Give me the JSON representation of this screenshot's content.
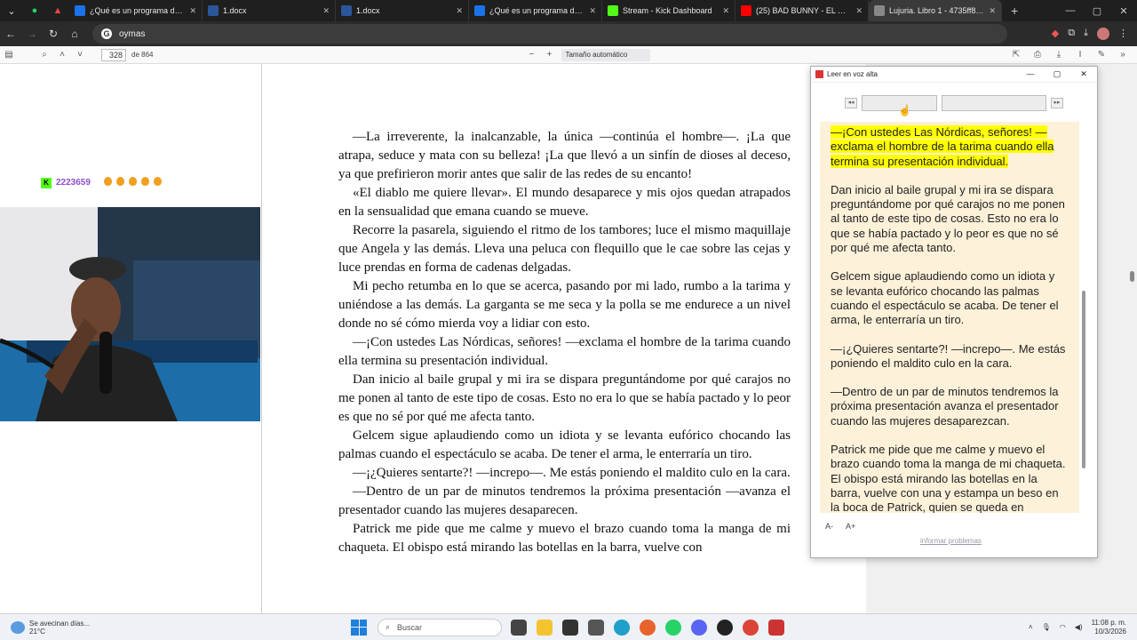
{
  "tabs": [
    {
      "title": "¿Qué es un programa de pr",
      "color": "#1a73e8"
    },
    {
      "title": "1.docx",
      "color": "#2b579a"
    },
    {
      "title": "1.docx",
      "color": "#2b579a"
    },
    {
      "title": "¿Qué es un programa de pr",
      "color": "#1a73e8"
    },
    {
      "title": "Stream - Kick Dashboard",
      "color": "#53fc18"
    },
    {
      "title": "(25) BAD BUNNY - EL CLÚB",
      "color": "#ff0000"
    },
    {
      "title": "Lujuria. Libro 1 - 4735ff84-a",
      "color": "#888888"
    }
  ],
  "address": {
    "text": "oymas"
  },
  "pdf": {
    "page": "328",
    "of_pages": "de 864",
    "zoom": "Tamaño automático"
  },
  "overlay": {
    "viewer_count": "2223659"
  },
  "document": {
    "paragraphs": [
      "—La irreverente, la inalcanzable, la única —continúa el hombre—. ¡La que atrapa, seduce y mata con su belleza! ¡La que llevó a un sinfín de dioses al deceso, ya que prefirieron morir antes que salir de las redes de su encanto!",
      "«El diablo me quiere llevar». El mundo desaparece y mis ojos quedan atrapados en la sensualidad que emana cuando se mueve.",
      "Recorre la pasarela, siguiendo el ritmo de los tambores; luce el mismo maquillaje que Angela y las demás. Lleva una peluca con flequillo que le cae sobre las cejas y luce prendas en forma de cadenas delgadas.",
      "Mi pecho retumba en lo que se acerca, pasando por mi lado, rumbo a la tarima y uniéndose a las demás. La garganta se me seca y la polla se me endurece a un nivel donde no sé cómo mierda voy a lidiar con esto.",
      "—¡Con ustedes Las Nórdicas, señores! —exclama el hombre de la tarima cuando ella termina su presentación individual.",
      "Dan inicio al baile grupal y mi ira se dispara preguntándome por qué carajos no me ponen al tanto de este tipo de cosas. Esto no era lo que se había pactado y lo peor es que no sé por qué me afecta tanto.",
      "Gelcem sigue aplaudiendo como un idiota y se levanta eufórico chocando las palmas cuando el espectáculo se acaba. De tener el arma, le enterraría un tiro.",
      "—¡¿Quieres sentarte?! —increpo—. Me estás poniendo el maldito culo en la cara.",
      "—Dentro de un par de minutos tendremos la próxima presentación —avanza el presentador cuando las mujeres desaparecen.",
      "Patrick me pide que me calme y muevo el brazo cuando toma la manga de mi chaqueta. El obispo está mirando las botellas en la barra, vuelve con"
    ]
  },
  "read_aloud": {
    "title": "Leer en voz alta",
    "highlighted": "—¡Con ustedes Las Nórdicas, señores! —exclama el hombre de la tarima cuando ella termina su presentación individual.",
    "paragraphs": [
      "Dan inicio al baile grupal y mi ira se dispara preguntándome por qué carajos no me ponen al tanto de este tipo de cosas. Esto no era lo que se había pactado y lo peor es que no sé por qué me afecta tanto.",
      "Gelcem sigue aplaudiendo como un idiota y se levanta eufórico chocando las palmas cuando el espectáculo se acaba. De tener el arma, le enterraría un tiro.",
      "—¡¿Quieres sentarte?! —increpo—. Me estás poniendo el maldito culo en la cara.",
      "—Dentro de un par de minutos tendremos la próxima presentación avanza el presentador cuando las mujeres desaparezcan.",
      "Patrick me pide que me calme y muevo el brazo cuando toma la manga de mi chaqueta. El obispo está mirando las botellas en la barra, vuelve con una y estampa un beso en la boca de Patrick, quien se queda en"
    ],
    "font_minus": "A-",
    "font_plus": "A+",
    "report_link": "informar problemas"
  },
  "taskbar": {
    "weather_line1": "Se avecinan días...",
    "weather_line2": "21°C",
    "search_placeholder": "Buscar",
    "time": "11:08 p. m.",
    "date": "10/3/2026"
  }
}
